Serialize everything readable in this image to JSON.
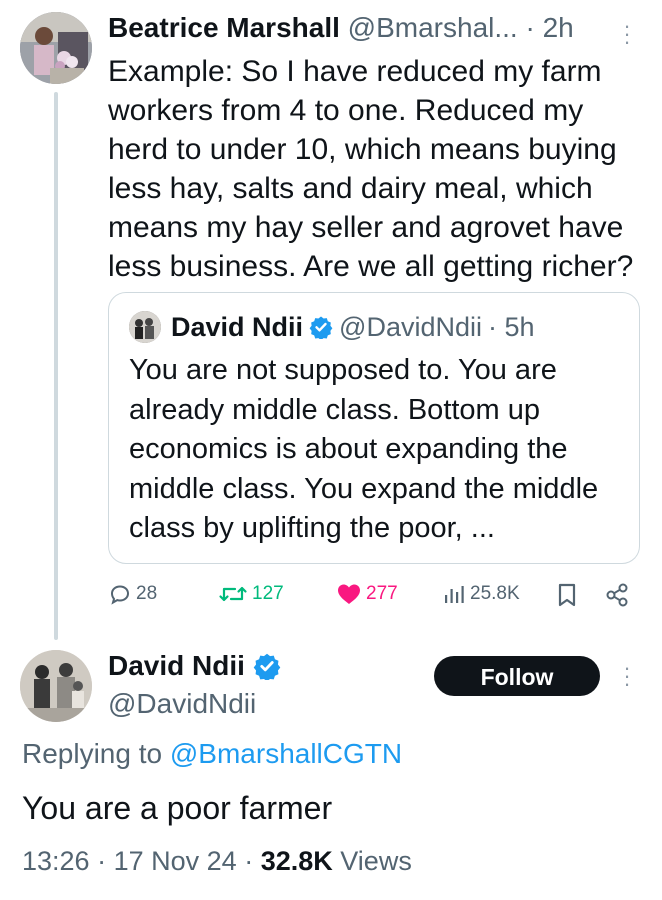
{
  "parent_tweet": {
    "author_name": "Beatrice Marshall",
    "author_handle": "@Bmarshal...",
    "time": "· 2h",
    "text": "Example: So I have reduced my farm workers from 4 to one. Reduced my herd to under 10, which means buying less hay, salts and dairy meal, which means my hay seller and agrovet have less business. Are we all getting richer?",
    "quote": {
      "author_name": "David Ndii",
      "author_handle": "@DavidNdii",
      "time": "· 5h",
      "text": "You are not supposed to. You are already middle class. Bottom up economics is about expanding the middle class. You expand the middle class by uplifting the poor, ..."
    },
    "actions": {
      "replies": "28",
      "retweets": "127",
      "likes": "277",
      "views": "25.8K"
    }
  },
  "main_tweet": {
    "author_name": "David Ndii",
    "author_handle": "@DavidNdii",
    "follow_label": "Follow",
    "replying_prefix": "Replying to",
    "replying_handle": "@BmarshallCGTN",
    "text": "You are a poor farmer",
    "time": "13:26",
    "date": "17 Nov 24",
    "views_count": "32.8K",
    "views_label": "Views"
  },
  "colors": {
    "accent_blue": "#1d9bf0",
    "retweet_green": "#00ba7c",
    "like_pink": "#f91880",
    "text_primary": "#0f1419",
    "text_secondary": "#536471"
  }
}
